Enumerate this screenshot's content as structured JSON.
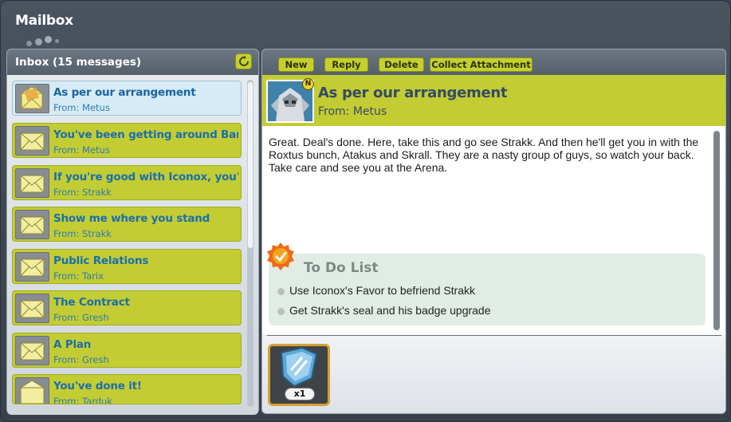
{
  "window": {
    "title": "Mailbox"
  },
  "inbox": {
    "title": "Inbox (15 messages)",
    "messages": [
      {
        "subject": "As per our arrangement",
        "from": "From: Metus",
        "selected": true
      },
      {
        "subject": "You've been getting around Bara M",
        "from": "From: Metus"
      },
      {
        "subject": "If you're good with Iconox, you're g",
        "from": "From: Strakk"
      },
      {
        "subject": "Show me where you stand",
        "from": "From: Strakk"
      },
      {
        "subject": "Public Relations",
        "from": "From: Tarix"
      },
      {
        "subject": "The Contract",
        "from": "From: Gresh"
      },
      {
        "subject": "A Plan",
        "from": "From: Gresh"
      },
      {
        "subject": "You've done it!",
        "from": "From: Tarduk"
      }
    ]
  },
  "toolbar": {
    "new_label": "New",
    "reply_label": "Reply",
    "delete_label": "Delete",
    "collect_label": "Collect Attachment"
  },
  "message": {
    "subject": "As per our arrangement",
    "from": "From: Metus",
    "badge": "N",
    "body": "Great. Deal's done. Here, take this and go see Strakk. And then he'll get you in with the Roxtus bunch, Atakus and Skrall. They are a nasty group of guys, so watch your back. Take care and see you at the Arena.",
    "todo": {
      "title": "To Do List",
      "items": [
        "Use Iconox's Favor to befriend Strakk",
        "Get Strakk's seal and his badge upgrade"
      ]
    },
    "attachment": {
      "quantity": "x1",
      "icon": "badge-shield-icon"
    }
  },
  "colors": {
    "accent_lime": "#c3cc32",
    "link_blue": "#1a6fae",
    "panel_bg": "#3f4852"
  }
}
